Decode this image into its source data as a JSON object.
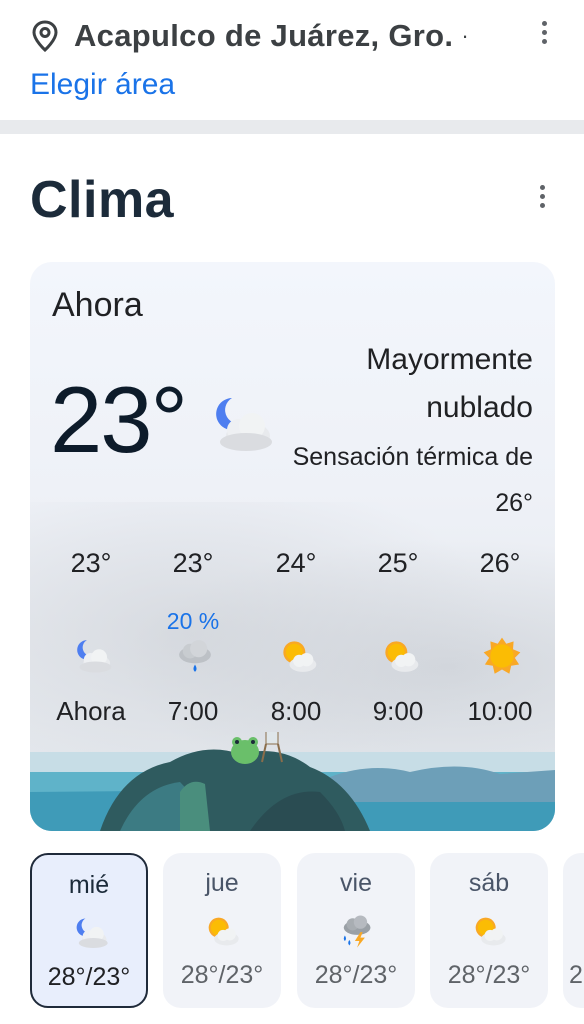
{
  "header": {
    "location": "Acapulco de Juárez, Gro.",
    "location_separator": "·",
    "choose_area": "Elegir área"
  },
  "section": {
    "title": "Clima"
  },
  "current": {
    "label": "Ahora",
    "temperature": "23°",
    "condition_icon": "moon-cloud-icon",
    "condition": "Mayormente nublado",
    "feels_like": "Sensación térmica de 26°"
  },
  "hourly": [
    {
      "temp": "23°",
      "precip": "",
      "icon": "moon-cloud-icon",
      "time": "Ahora"
    },
    {
      "temp": "23°",
      "precip": "20 %",
      "icon": "rain-cloud-icon",
      "time": "7:00"
    },
    {
      "temp": "24°",
      "precip": "",
      "icon": "sun-cloud-icon",
      "time": "8:00"
    },
    {
      "temp": "25°",
      "precip": "",
      "icon": "sun-cloud-icon",
      "time": "9:00"
    },
    {
      "temp": "26°",
      "precip": "",
      "icon": "sun-icon",
      "time": "10:00"
    }
  ],
  "daily": [
    {
      "day": "mié",
      "icon": "moon-cloud-icon",
      "range": "28°/23°",
      "selected": true
    },
    {
      "day": "jue",
      "icon": "sun-cloud-icon",
      "range": "28°/23°",
      "selected": false
    },
    {
      "day": "vie",
      "icon": "thunderstorm-icon",
      "range": "28°/23°",
      "selected": false
    },
    {
      "day": "sáb",
      "icon": "sun-cloud-icon",
      "range": "28°/23°",
      "selected": false
    },
    {
      "day": "",
      "icon": "",
      "range": "2",
      "selected": false
    }
  ],
  "colors": {
    "accent": "#1a73e8",
    "title": "#1c2b3a",
    "sun": "#f9a825"
  }
}
